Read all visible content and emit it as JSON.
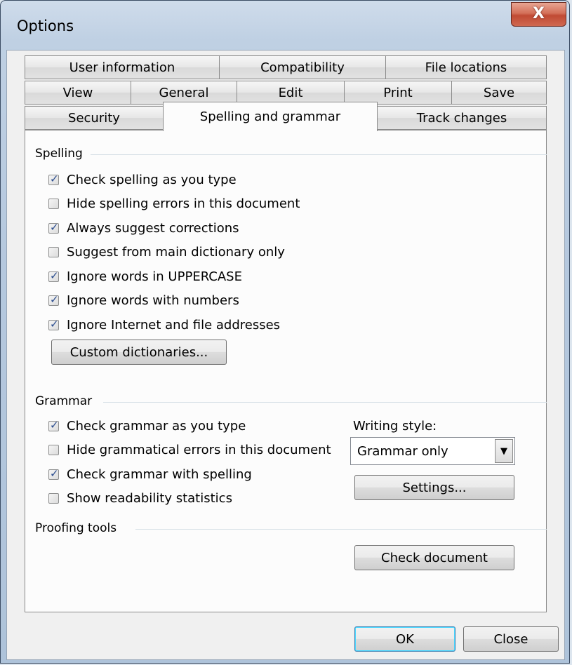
{
  "window": {
    "title": "Options",
    "close_glyph": "X"
  },
  "tabs": {
    "row1": [
      "User information",
      "Compatibility",
      "File locations"
    ],
    "row2": [
      "View",
      "General",
      "Edit",
      "Print",
      "Save"
    ],
    "row3": [
      "Security",
      "Spelling and grammar",
      "Track changes"
    ],
    "active": "Spelling and grammar"
  },
  "spelling": {
    "title": "Spelling",
    "options": [
      {
        "label": "Check spelling as you type",
        "checked": true
      },
      {
        "label": "Hide spelling errors in this document",
        "checked": false
      },
      {
        "label": "Always suggest corrections",
        "checked": true
      },
      {
        "label": "Suggest from main dictionary only",
        "checked": false
      },
      {
        "label": "Ignore words in UPPERCASE",
        "checked": true
      },
      {
        "label": "Ignore words with numbers",
        "checked": true
      },
      {
        "label": "Ignore Internet and file addresses",
        "checked": true
      }
    ],
    "custom_dictionaries_label": "Custom dictionaries..."
  },
  "grammar": {
    "title": "Grammar",
    "options": [
      {
        "label": "Check grammar as you type",
        "checked": true
      },
      {
        "label": "Hide grammatical errors in this document",
        "checked": false
      },
      {
        "label": "Check grammar with spelling",
        "checked": true
      },
      {
        "label": "Show readability statistics",
        "checked": false
      }
    ],
    "writing_style_label": "Writing style:",
    "writing_style_value": "Grammar only",
    "settings_label": "Settings..."
  },
  "proofing": {
    "title": "Proofing tools",
    "check_document_label": "Check document"
  },
  "footer": {
    "ok_label": "OK",
    "close_label": "Close"
  },
  "icons": {
    "checkbox_tick": "✓",
    "dropdown_arrow": "▼"
  }
}
